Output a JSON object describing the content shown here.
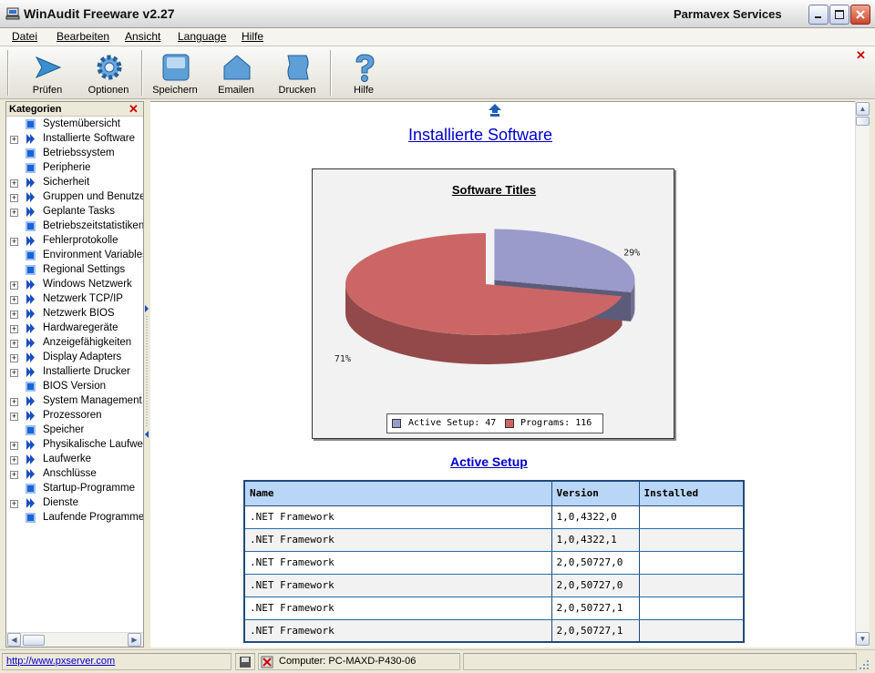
{
  "window": {
    "title": "WinAudit Freeware v2.27",
    "vendor": "Parmavex Services"
  },
  "menu": [
    "Datei",
    "Bearbeiten",
    "Ansicht",
    "Language",
    "Hilfe"
  ],
  "toolbar": {
    "buttons": [
      {
        "label": "Prüfen",
        "icon": "play-arrow-icon"
      },
      {
        "label": "Optionen",
        "icon": "gear-icon"
      },
      {
        "label": "Speichern",
        "icon": "save-icon"
      },
      {
        "label": "Emailen",
        "icon": "house-icon"
      },
      {
        "label": "Drucken",
        "icon": "scroll-icon"
      },
      {
        "label": "Hilfe",
        "icon": "question-icon"
      }
    ]
  },
  "sidebar": {
    "title": "Kategorien",
    "items": [
      {
        "label": "Systemübersicht",
        "expandable": false
      },
      {
        "label": "Installierte Software",
        "expandable": true
      },
      {
        "label": "Betriebssystem",
        "expandable": false
      },
      {
        "label": "Peripherie",
        "expandable": false
      },
      {
        "label": "Sicherheit",
        "expandable": true
      },
      {
        "label": "Gruppen und Benutzer",
        "expandable": true
      },
      {
        "label": "Geplante Tasks",
        "expandable": true
      },
      {
        "label": "Betriebszeitstatistiken",
        "expandable": false
      },
      {
        "label": "Fehlerprotokolle",
        "expandable": true
      },
      {
        "label": "Environment Variables",
        "expandable": false
      },
      {
        "label": "Regional Settings",
        "expandable": false
      },
      {
        "label": "Windows Netzwerk",
        "expandable": true
      },
      {
        "label": "Netzwerk TCP/IP",
        "expandable": true
      },
      {
        "label": "Netzwerk BIOS",
        "expandable": true
      },
      {
        "label": "Hardwaregeräte",
        "expandable": true
      },
      {
        "label": "Anzeigefähigkeiten",
        "expandable": true
      },
      {
        "label": "Display Adapters",
        "expandable": true
      },
      {
        "label": "Installierte Drucker",
        "expandable": true
      },
      {
        "label": "BIOS Version",
        "expandable": false
      },
      {
        "label": "System Management",
        "expandable": true
      },
      {
        "label": "Prozessoren",
        "expandable": true
      },
      {
        "label": "Speicher",
        "expandable": false
      },
      {
        "label": "Physikalische Laufwerke",
        "expandable": true
      },
      {
        "label": "Laufwerke",
        "expandable": true
      },
      {
        "label": "Anschlüsse",
        "expandable": true
      },
      {
        "label": "Startup-Programme",
        "expandable": false
      },
      {
        "label": "Dienste",
        "expandable": true
      },
      {
        "label": "Laufende Programme",
        "expandable": false
      }
    ]
  },
  "content": {
    "heading": "Installierte Software",
    "section_link": "Active Setup",
    "table": {
      "headers": [
        "Name",
        "Version",
        "Installed"
      ],
      "rows": [
        [
          ".NET Framework",
          "1,0,4322,0",
          ""
        ],
        [
          ".NET Framework",
          "1,0,4322,1",
          ""
        ],
        [
          ".NET Framework",
          "2,0,50727,0",
          ""
        ],
        [
          ".NET Framework",
          "2,0,50727,0",
          ""
        ],
        [
          ".NET Framework",
          "2,0,50727,1",
          ""
        ],
        [
          ".NET Framework",
          "2,0,50727,1",
          ""
        ]
      ]
    }
  },
  "chart_data": {
    "type": "pie",
    "title": "Software Titles",
    "slices": [
      {
        "label": "Active Setup",
        "value": 47,
        "percent_label": "29%",
        "color": "#9a9acb"
      },
      {
        "label": "Programs",
        "value": 116,
        "percent_label": "71%",
        "color": "#cc6666"
      }
    ],
    "legend": [
      "Active Setup: 47",
      "Programs: 116"
    ],
    "legend_placement": "bottom"
  },
  "statusbar": {
    "link": "http://www.pxserver.com",
    "computer": "Computer: PC-MAXD-P430-06"
  },
  "colors": {
    "link": "#0000cc",
    "table_header": "#b9d6f7",
    "table_border": "#1f4a7a"
  }
}
